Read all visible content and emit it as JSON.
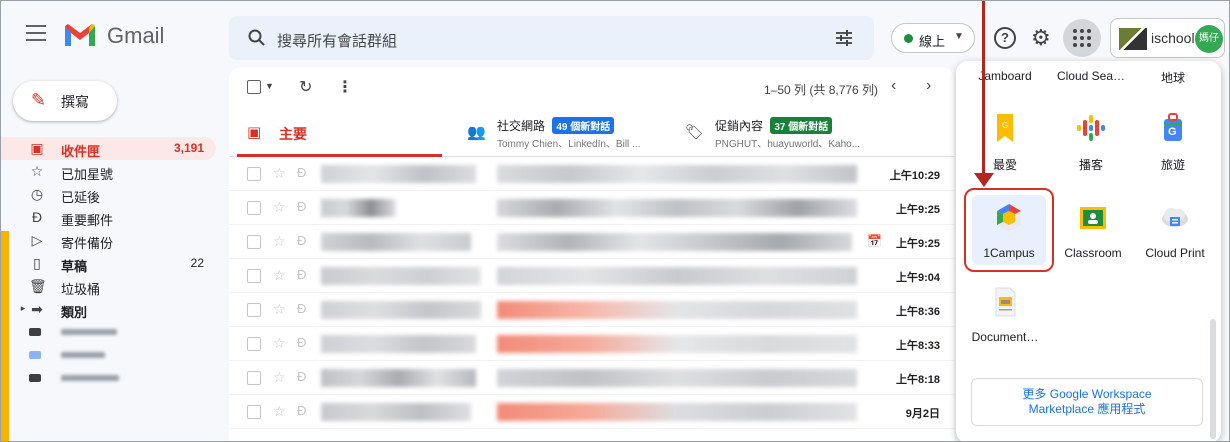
{
  "header": {
    "app_name": "Gmail",
    "search_placeholder": "搜尋所有會話群組",
    "status_label": "線上",
    "account_name": "ischool",
    "avatar_text": "媽仔"
  },
  "sidebar": {
    "compose_label": "撰寫",
    "items": [
      {
        "label": "收件匣",
        "count": "3,191",
        "icon": "inbox-icon"
      },
      {
        "label": "已加星號",
        "count": "",
        "icon": "star-icon"
      },
      {
        "label": "已延後",
        "count": "",
        "icon": "clock-icon"
      },
      {
        "label": "重要郵件",
        "count": "",
        "icon": "important-icon"
      },
      {
        "label": "寄件備份",
        "count": "",
        "icon": "send-icon"
      },
      {
        "label": "草稿",
        "count": "22",
        "icon": "draft-icon"
      },
      {
        "label": "垃圾桶",
        "count": "",
        "icon": "trash-icon"
      },
      {
        "label": "類別",
        "count": "",
        "icon": "label-icon"
      }
    ],
    "label_colors": [
      "#3c4043",
      "#8ab4f8",
      "#3c4043"
    ]
  },
  "toolbar": {
    "range_text": "1–50 列 (共 8,776 列)"
  },
  "tabs": {
    "primary": "主要",
    "social": {
      "name": "社交網路",
      "badge": "49 個新對話",
      "senders": "Tommy Chien、LinkedIn、Bill ..."
    },
    "promotions": {
      "name": "促銷內容",
      "badge": "37 個新對話",
      "senders": "PNGHUT、huayuworld、Kaho..."
    }
  },
  "emails": [
    {
      "time": "上午10:29"
    },
    {
      "time": "上午9:25"
    },
    {
      "time": "上午9:25"
    },
    {
      "time": "上午9:04"
    },
    {
      "time": "上午8:36"
    },
    {
      "time": "上午8:33"
    },
    {
      "time": "上午8:18"
    },
    {
      "time": "9月2日"
    }
  ],
  "apps_panel": {
    "top_labels": [
      "Jamboard",
      "Cloud Sea…",
      "地球"
    ],
    "row1": [
      "最愛",
      "播客",
      "旅遊"
    ],
    "row2": [
      "1Campus",
      "Classroom",
      "Cloud Print"
    ],
    "row3": [
      "Document…"
    ],
    "more_line1": "更多 Google Workspace",
    "more_line2": "Marketplace 應用程式"
  },
  "colors": {
    "gmail_red": "#d93025",
    "accent_blue": "#1a73e8",
    "social_badge": "#1a73e8",
    "promo_badge": "#188038"
  }
}
